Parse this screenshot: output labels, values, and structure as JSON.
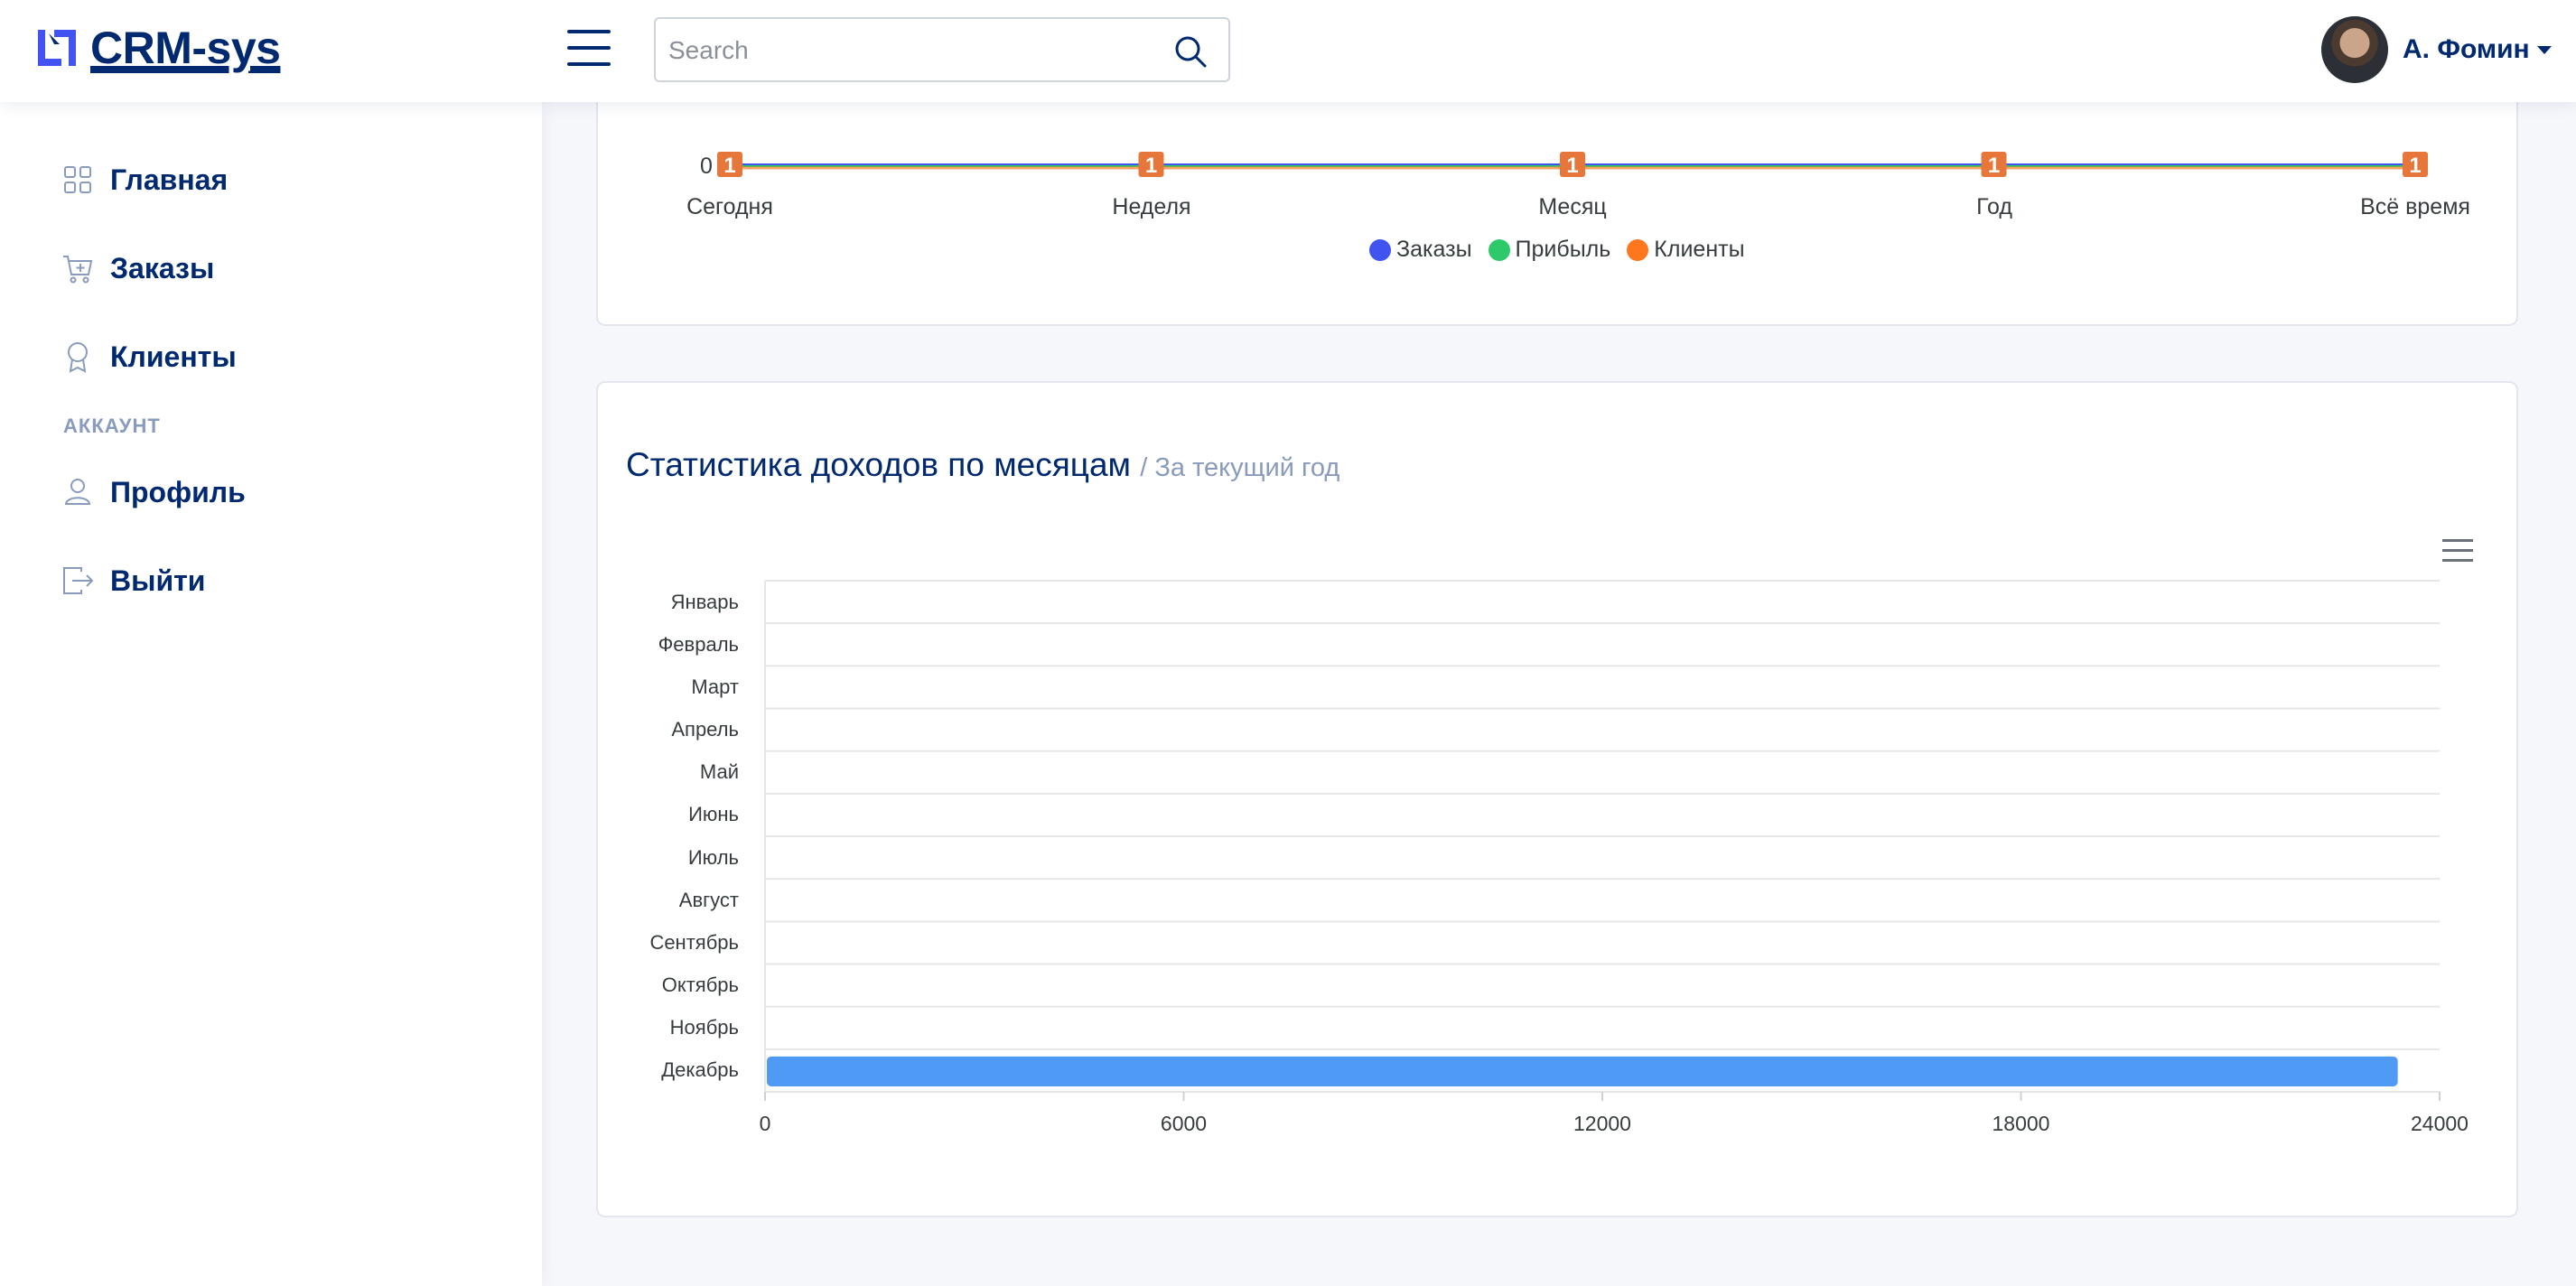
{
  "header": {
    "logo_text": "CRM-sys",
    "search_placeholder": "Search",
    "user_name": "А. Фомин",
    "accent_color": "#4154f1"
  },
  "sidebar": {
    "items": [
      {
        "label": "Главная",
        "icon": "grid-icon"
      },
      {
        "label": "Заказы",
        "icon": "cart-plus-icon"
      },
      {
        "label": "Клиенты",
        "icon": "award-icon"
      }
    ],
    "account_heading": "АККАУНТ",
    "account_items": [
      {
        "label": "Профиль",
        "icon": "person-icon"
      },
      {
        "label": "Выйти",
        "icon": "box-arrow-right-icon"
      }
    ]
  },
  "overview_chart": {
    "zero_label": "0",
    "categories": [
      "Сегодня",
      "Неделя",
      "Месяц",
      "Год",
      "Всё время"
    ],
    "marker_values": [
      "1",
      "1",
      "1",
      "1",
      "1"
    ],
    "legend": [
      {
        "label": "Заказы",
        "color": "#4154f1"
      },
      {
        "label": "Прибыль",
        "color": "#2eca6a"
      },
      {
        "label": "Клиенты",
        "color": "#ff771d"
      }
    ]
  },
  "income_card": {
    "title": "Статистика доходов по месяцам",
    "subtitle": "/ За текущий год"
  },
  "chart_data": [
    {
      "type": "line",
      "categories": [
        "Сегодня",
        "Неделя",
        "Месяц",
        "Год",
        "Всё время"
      ],
      "series": [
        {
          "name": "Заказы",
          "values": [
            1,
            1,
            1,
            1,
            1
          ]
        },
        {
          "name": "Прибыль",
          "values": [
            1,
            1,
            1,
            1,
            1
          ]
        },
        {
          "name": "Клиенты",
          "values": [
            1,
            1,
            1,
            1,
            1
          ]
        }
      ],
      "colors": [
        "#4154f1",
        "#2eca6a",
        "#ff771d"
      ],
      "legend": "bottom"
    },
    {
      "type": "bar",
      "orientation": "horizontal",
      "title": "Статистика доходов по месяцам",
      "subtitle": "/ За текущий год",
      "categories": [
        "Январь",
        "Февраль",
        "Март",
        "Апрель",
        "Май",
        "Июнь",
        "Июль",
        "Август",
        "Сентябрь",
        "Октябрь",
        "Ноябрь",
        "Декабрь"
      ],
      "values": [
        0,
        0,
        0,
        0,
        0,
        0,
        0,
        0,
        0,
        0,
        0,
        23400
      ],
      "xlim": [
        0,
        24000
      ],
      "xticks": [
        "0",
        "6000",
        "12000",
        "18000",
        "24000"
      ],
      "bar_color": "#4e9af5",
      "grid": true
    }
  ]
}
